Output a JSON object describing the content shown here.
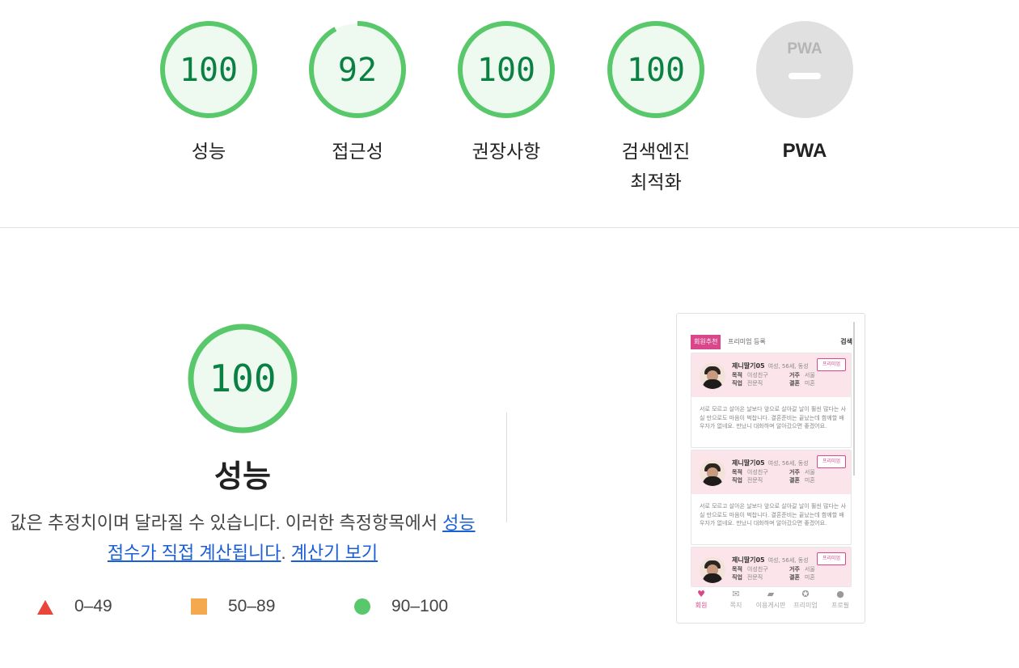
{
  "colors": {
    "pass": "#0b8043",
    "pass_ring": "#58c86b",
    "pass_fill": "#eefaf0",
    "pwa_gray": "#e0e0e0",
    "fail": "#e8453c",
    "average": "#f5a94f",
    "link": "#1a5fd6",
    "brand_pink": "#d9468a"
  },
  "gauges": [
    {
      "score": "100",
      "value": 100,
      "label": "성능"
    },
    {
      "score": "92",
      "value": 92,
      "label": "접근성"
    },
    {
      "score": "100",
      "value": 100,
      "label": "권장사항"
    },
    {
      "score": "100",
      "value": 100,
      "label": "검색엔진\n최적화"
    }
  ],
  "pwa": {
    "badge": "PWA",
    "label": "PWA"
  },
  "performance": {
    "score": "100",
    "value": 100,
    "title": "성능",
    "description_pre": "값은 추정치이며 달라질 수 있습니다. 이러한 측정항목에서 ",
    "link1": "성능 점수가 직접 계산됩니다",
    "description_mid": ". ",
    "link2": "계산기 보기"
  },
  "legend": [
    {
      "symbol": "triangle",
      "range": "0–49"
    },
    {
      "symbol": "square",
      "range": "50–89"
    },
    {
      "symbol": "circle",
      "range": "90–100"
    }
  ],
  "screenshot": {
    "tab_active": "회원추천",
    "tab_other": "프리미엄 등록",
    "search": "검색",
    "cards": [
      {
        "name": "제니딸기05",
        "meta": "여성, 56세, 동성",
        "purpose_label": "목적",
        "purpose": "이성친구",
        "residence_label": "거주",
        "residence": "서울",
        "job_label": "직업",
        "job": "전문직",
        "marriage_label": "결혼",
        "marriage": "미혼",
        "badge": "프리미엄",
        "body": "서로 모르고 살아온 날보다 앞으로 살아갈 날이 훨씬 많다는 사실 만으로도 마음이 벅찹니다. 결혼준비는 끝났는데 함께할 배우자가 없네요. 만났니 대화하며 알아갔으면 좋겠어요."
      },
      {
        "name": "제니딸기05",
        "meta": "여성, 56세, 동성",
        "purpose_label": "목적",
        "purpose": "이성친구",
        "residence_label": "거주",
        "residence": "서울",
        "job_label": "직업",
        "job": "전문직",
        "marriage_label": "결혼",
        "marriage": "미혼",
        "badge": "프리미엄",
        "body": "서로 모르고 살아온 날보다 앞으로 살아갈 날이 훨씬 많다는 사실 만으로도 마음이 벅찹니다. 결혼준비는 끝났는데 함께할 배우자가 없네요. 만났니 대화하며 알아갔으면 좋겠어요."
      },
      {
        "name": "제니딸기05",
        "meta": "여성, 56세, 동성",
        "purpose_label": "목적",
        "purpose": "이성친구",
        "residence_label": "거주",
        "residence": "서울",
        "job_label": "직업",
        "job": "전문직",
        "marriage_label": "결혼",
        "marriage": "미혼",
        "badge": "프리미엄",
        "body": ""
      }
    ],
    "nav": [
      {
        "icon": "heart-icon",
        "glyph": "♥",
        "label": "회원"
      },
      {
        "icon": "mail-icon",
        "glyph": "✉",
        "label": "쪽지"
      },
      {
        "icon": "chat-icon",
        "glyph": "▰",
        "label": "이용게시판"
      },
      {
        "icon": "star-icon",
        "glyph": "✪",
        "label": "프리미엄"
      },
      {
        "icon": "profile-icon",
        "glyph": "●",
        "label": "프로필"
      }
    ]
  }
}
